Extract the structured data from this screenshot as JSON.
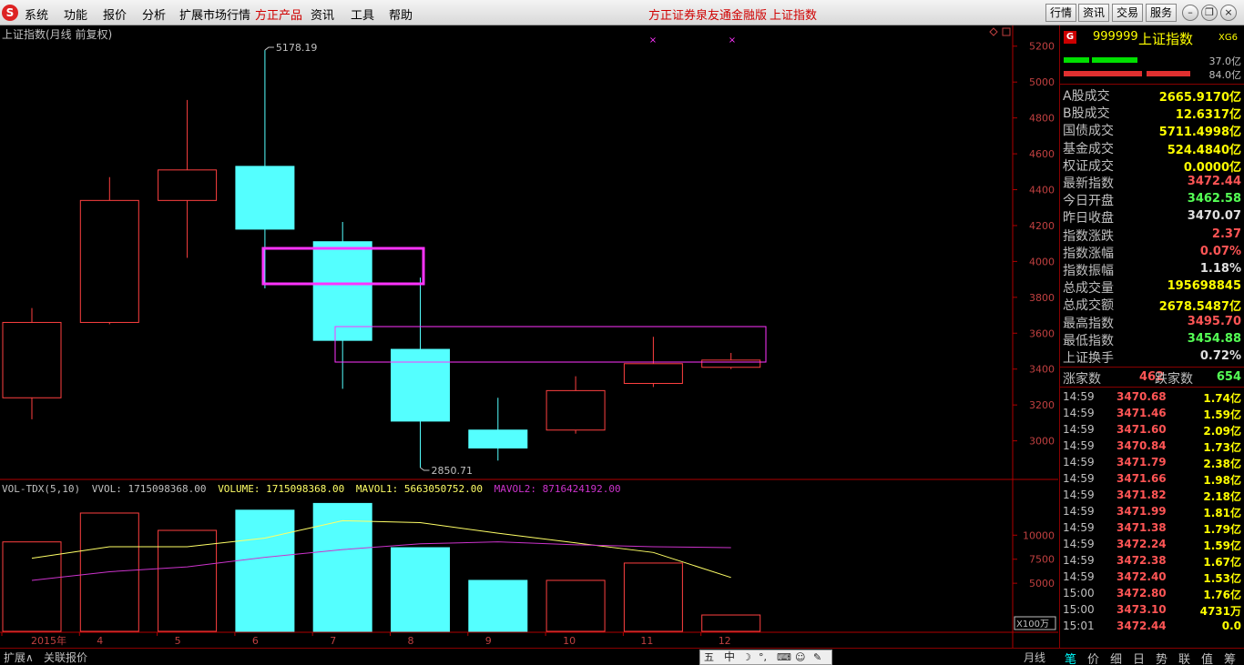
{
  "menu": {
    "items": [
      "系统",
      "功能",
      "报价",
      "分析",
      "扩展市场行情",
      "方正产品",
      "资讯",
      "工具",
      "帮助"
    ],
    "center_labels": [
      "方正证券泉友通金融版",
      "上证指数"
    ],
    "right_buttons": [
      "行情",
      "资讯",
      "交易",
      "服务"
    ]
  },
  "chart": {
    "title": "上证指数(月线 前复权)",
    "high_label": "5178.19",
    "low_label": "2850.71",
    "period_label": "月线",
    "vol_unit": "X100万",
    "vol_legend": {
      "name": "VOL-TDX(5,10)",
      "vol": "VVOL: 1715098368.00",
      "volume": "VOLUME: 1715098368.00",
      "mavol1": "MAVOL1: 5663050752.00",
      "mavol2": "MAVOL2: 8716424192.00"
    }
  },
  "chart_data": {
    "type": "candlestick",
    "categories": [
      "2015年",
      "4",
      "5",
      "6",
      "7",
      "8",
      "9",
      "10",
      "11",
      "12"
    ],
    "price_axis": {
      "ticks": [
        3000,
        3200,
        3400,
        3600,
        3800,
        4000,
        4200,
        4400,
        4600,
        4800,
        5000,
        5200
      ],
      "range": [
        2790,
        5290
      ]
    },
    "candles": [
      {
        "open": 3240,
        "close": 3660,
        "high": 3740,
        "low": 3120,
        "up": true
      },
      {
        "open": 3660,
        "close": 4340,
        "high": 4470,
        "low": 3650,
        "up": true
      },
      {
        "open": 4340,
        "close": 4510,
        "high": 4900,
        "low": 4020,
        "up": true
      },
      {
        "open": 4530,
        "close": 4180,
        "high": 5178.19,
        "low": 3850,
        "up": false
      },
      {
        "open": 4110,
        "close": 3560,
        "high": 4220,
        "low": 3290,
        "up": false
      },
      {
        "open": 3510,
        "close": 3110,
        "high": 3910,
        "low": 2850.71,
        "up": false
      },
      {
        "open": 3060,
        "close": 2960,
        "high": 3240,
        "low": 2890,
        "up": false
      },
      {
        "open": 3060,
        "close": 3280,
        "high": 3360,
        "low": 3040,
        "up": true
      },
      {
        "open": 3320,
        "close": 3430,
        "high": 3580,
        "low": 3300,
        "up": true
      },
      {
        "open": 3410,
        "close": 3450,
        "high": 3490,
        "low": 3400,
        "up": true
      }
    ],
    "volume_axis": {
      "ticks": [
        5000,
        7500,
        10000
      ],
      "range": [
        0,
        14000
      ]
    },
    "volumes": [
      9300,
      12300,
      10500,
      12600,
      13300,
      8700,
      5300,
      5300,
      7100,
      1700
    ],
    "mavol1": [
      7600,
      8800,
      8800,
      9700,
      11500,
      11300,
      10200,
      9200,
      8200,
      5600
    ],
    "mavol2": [
      5300,
      6200,
      6700,
      7700,
      8500,
      9100,
      9300,
      9000,
      8800,
      8700
    ],
    "grid": false
  },
  "quote": {
    "badge": "G",
    "code": "999999",
    "name": "上证指数",
    "tag": "XG6",
    "bar1_label": "37.0亿",
    "bar2_label": "84.0亿",
    "rows": [
      {
        "k": "A股成交",
        "v": "2665.9170亿",
        "c": "#ffff00"
      },
      {
        "k": "B股成交",
        "v": "12.6317亿",
        "c": "#ffff00"
      },
      {
        "k": "国债成交",
        "v": "5711.4998亿",
        "c": "#ffff00"
      },
      {
        "k": "基金成交",
        "v": "524.4840亿",
        "c": "#ffff00"
      },
      {
        "k": "权证成交",
        "v": "0.0000亿",
        "c": "#ffff00"
      },
      {
        "k": "最新指数",
        "v": "3472.44",
        "c": "#ff5555"
      },
      {
        "k": "今日开盘",
        "v": "3462.58",
        "c": "#55ff55"
      },
      {
        "k": "昨日收盘",
        "v": "3470.07",
        "c": "#e0e0e0"
      },
      {
        "k": "指数涨跌",
        "v": "2.37",
        "c": "#ff5555"
      },
      {
        "k": "指数涨幅",
        "v": "0.07%",
        "c": "#ff5555"
      },
      {
        "k": "指数振幅",
        "v": "1.18%",
        "c": "#e0e0e0"
      },
      {
        "k": "总成交量",
        "v": "195698845",
        "c": "#ffff00"
      },
      {
        "k": "总成交额",
        "v": "2678.5487亿",
        "c": "#ffff00"
      },
      {
        "k": "最高指数",
        "v": "3495.70",
        "c": "#ff5555"
      },
      {
        "k": "最低指数",
        "v": "3454.88",
        "c": "#55ff55"
      },
      {
        "k": "上证换手",
        "v": "0.72%",
        "c": "#e0e0e0"
      }
    ],
    "up_label": "涨家数",
    "up_value": "462",
    "down_label": "跌家数",
    "down_value": "654",
    "ticks": [
      {
        "t": "14:59",
        "p": "3470.68",
        "q": "1.74亿"
      },
      {
        "t": "14:59",
        "p": "3471.46",
        "q": "1.59亿"
      },
      {
        "t": "14:59",
        "p": "3471.60",
        "q": "2.09亿"
      },
      {
        "t": "14:59",
        "p": "3470.84",
        "q": "1.73亿"
      },
      {
        "t": "14:59",
        "p": "3471.79",
        "q": "2.38亿"
      },
      {
        "t": "14:59",
        "p": "3471.66",
        "q": "1.98亿"
      },
      {
        "t": "14:59",
        "p": "3471.82",
        "q": "2.18亿"
      },
      {
        "t": "14:59",
        "p": "3471.99",
        "q": "1.81亿"
      },
      {
        "t": "14:59",
        "p": "3471.38",
        "q": "1.79亿"
      },
      {
        "t": "14:59",
        "p": "3472.24",
        "q": "1.59亿"
      },
      {
        "t": "14:59",
        "p": "3472.38",
        "q": "1.67亿"
      },
      {
        "t": "14:59",
        "p": "3472.40",
        "q": "1.53亿"
      },
      {
        "t": "15:00",
        "p": "3472.80",
        "q": "1.76亿"
      },
      {
        "t": "15:00",
        "p": "3473.10",
        "q": "4731万"
      },
      {
        "t": "15:01",
        "p": "3472.44",
        "q": "0.0"
      }
    ]
  },
  "bottom": {
    "tabs": [
      "扩展∧",
      "关联报价"
    ],
    "side_tabs": [
      "笔",
      "价",
      "细",
      "日",
      "势",
      "联",
      "值",
      "筹"
    ]
  },
  "colors": {
    "up": "#ff4040",
    "down": "#54ffff",
    "mavol1": "#ffff66",
    "mavol2": "#cc33cc",
    "axis": "#b00000",
    "highlight": "#ff33ff"
  }
}
